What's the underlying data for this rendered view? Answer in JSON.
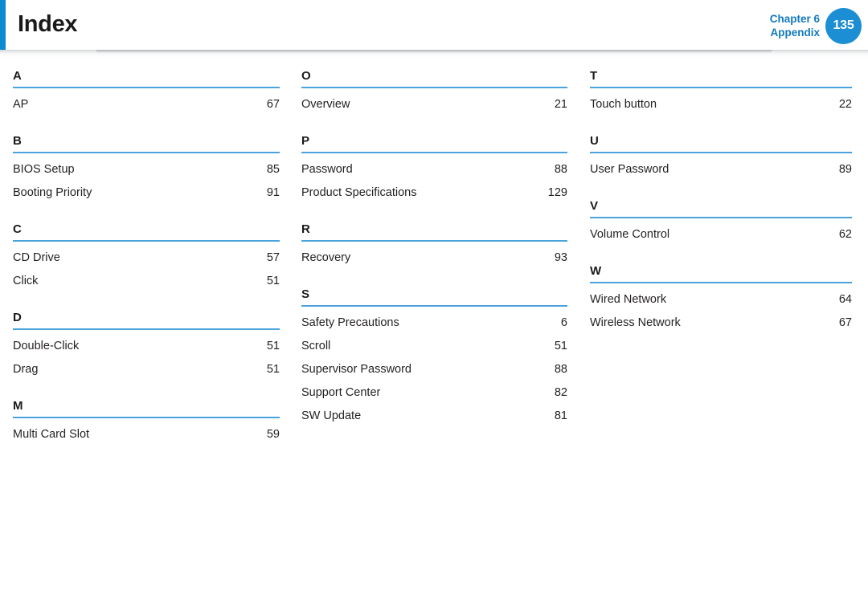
{
  "header": {
    "title": "Index",
    "chapter_line1": "Chapter 6",
    "chapter_line2": "Appendix",
    "page_number": "135",
    "accent_color": "#0c8ad0",
    "badge_color": "#1b8ed4",
    "chapter_text_color": "#1279c0",
    "rule_color": "#4aa3dc"
  },
  "columns": [
    {
      "groups": [
        {
          "letter": "A",
          "entries": [
            {
              "term": "AP",
              "page": "67"
            }
          ]
        },
        {
          "letter": "B",
          "entries": [
            {
              "term": "BIOS Setup",
              "page": "85"
            },
            {
              "term": "Booting Priority",
              "page": "91"
            }
          ]
        },
        {
          "letter": "C",
          "entries": [
            {
              "term": "CD Drive",
              "page": "57"
            },
            {
              "term": "Click",
              "page": "51"
            }
          ]
        },
        {
          "letter": "D",
          "entries": [
            {
              "term": "Double-Click",
              "page": "51"
            },
            {
              "term": "Drag",
              "page": "51"
            }
          ]
        },
        {
          "letter": "M",
          "entries": [
            {
              "term": "Multi Card Slot",
              "page": "59"
            }
          ]
        }
      ]
    },
    {
      "groups": [
        {
          "letter": "O",
          "entries": [
            {
              "term": "Overview",
              "page": "21"
            }
          ]
        },
        {
          "letter": "P",
          "entries": [
            {
              "term": "Password",
              "page": "88"
            },
            {
              "term": "Product Specifications",
              "page": "129"
            }
          ]
        },
        {
          "letter": "R",
          "entries": [
            {
              "term": "Recovery",
              "page": "93"
            }
          ]
        },
        {
          "letter": "S",
          "entries": [
            {
              "term": "Safety Precautions",
              "page": "6"
            },
            {
              "term": "Scroll",
              "page": "51"
            },
            {
              "term": "Supervisor Password",
              "page": "88"
            },
            {
              "term": "Support Center",
              "page": "82"
            },
            {
              "term": "SW Update",
              "page": "81"
            }
          ]
        }
      ]
    },
    {
      "groups": [
        {
          "letter": "T",
          "entries": [
            {
              "term": "Touch button",
              "page": "22"
            }
          ]
        },
        {
          "letter": "U",
          "entries": [
            {
              "term": "User Password",
              "page": "89"
            }
          ]
        },
        {
          "letter": "V",
          "entries": [
            {
              "term": "Volume Control",
              "page": "62"
            }
          ]
        },
        {
          "letter": "W",
          "entries": [
            {
              "term": "Wired Network",
              "page": "64"
            },
            {
              "term": "Wireless Network",
              "page": "67"
            }
          ]
        }
      ]
    }
  ]
}
